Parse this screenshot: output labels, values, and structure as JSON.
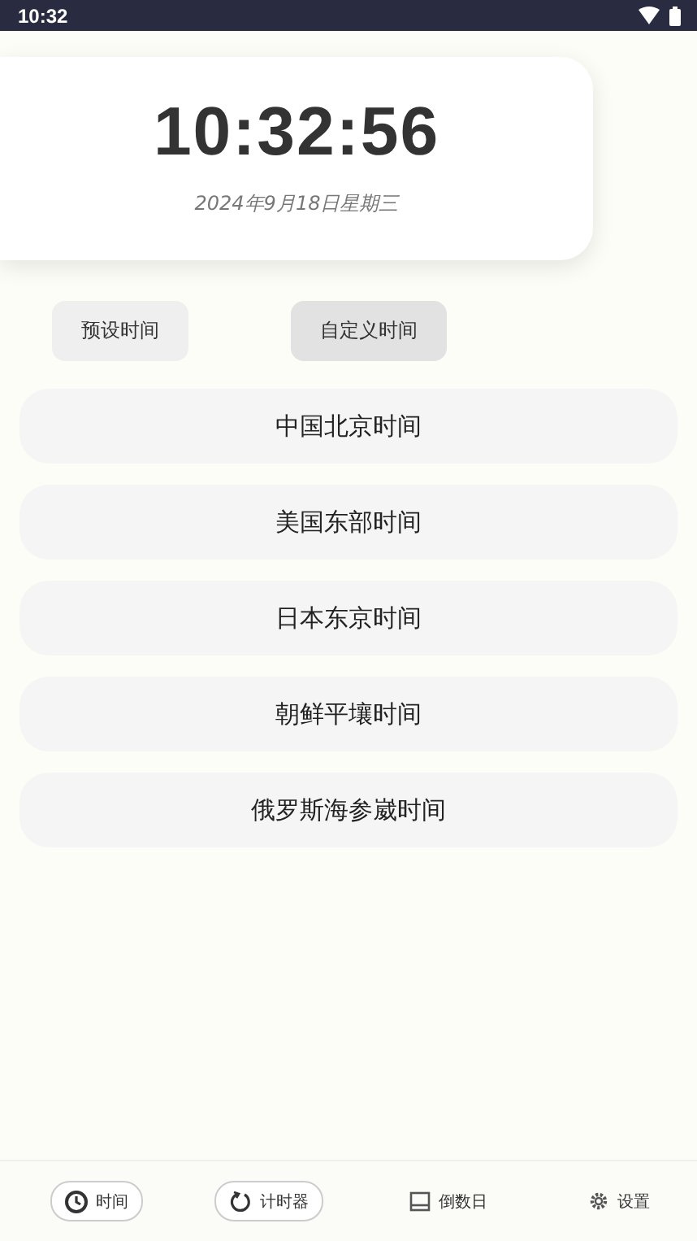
{
  "status_bar": {
    "time": "10:32"
  },
  "clock": {
    "time": "10:32:56",
    "date": "2024年9月18日星期三"
  },
  "modes": [
    {
      "label": "预设时间",
      "selected": false
    },
    {
      "label": "自定义时间",
      "selected": true
    }
  ],
  "zones": [
    "中国北京时间",
    "美国东部时间",
    "日本东京时间",
    "朝鲜平壤时间",
    "俄罗斯海参崴时间"
  ],
  "nav": [
    {
      "label": "时间",
      "outlined": true
    },
    {
      "label": "计时器",
      "outlined": true
    },
    {
      "label": "倒数日",
      "outlined": false
    },
    {
      "label": "设置",
      "outlined": false
    }
  ]
}
